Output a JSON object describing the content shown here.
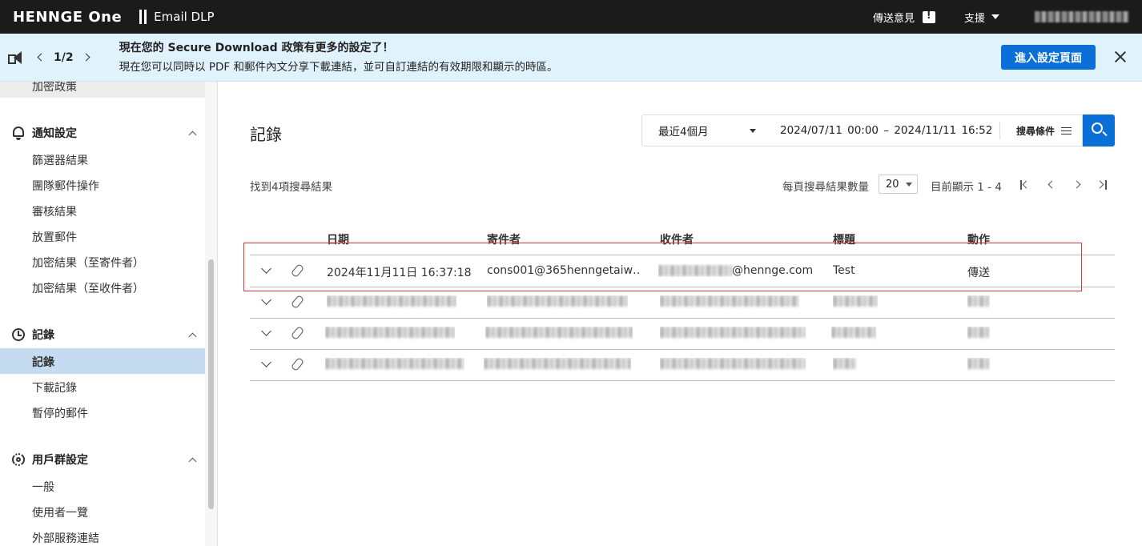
{
  "topbar": {
    "logo": "HENNGE One",
    "product": "Email DLP",
    "feedback_label": "傳送意見",
    "support_label": "支援"
  },
  "announcement": {
    "page": "1/2",
    "title": "現在您的 Secure Download 政策有更多的設定了！",
    "body": "現在您可以同時以 PDF 和郵件內文分享下載連結，並可自訂連結的有效期限和顯示的時區。",
    "button": "進入設定頁面"
  },
  "sidebar": {
    "top_item": "加密政策",
    "groups": [
      {
        "label": "通知設定",
        "items": [
          "篩選器結果",
          "團隊郵件操作",
          "審核結果",
          "放置郵件",
          "加密結果（至寄件者）",
          "加密結果（至收件者）"
        ]
      },
      {
        "label": "記錄",
        "items": [
          "記錄",
          "下載記錄",
          "暫停的郵件"
        ]
      },
      {
        "label": "用戶群設定",
        "items": [
          "一般",
          "使用者一覽",
          "外部服務連結"
        ]
      }
    ]
  },
  "main": {
    "title": "記錄",
    "range_select": "最近4個月",
    "date_range": "2024/07/11  00:00  –  2024/11/11  16:52",
    "conditions_label": "搜尋條件",
    "found_text": "找到4項搜尋結果",
    "per_page_label": "每頁搜尋結果數量",
    "per_page_value": "20",
    "showing_text": "目前顯示 1 - 4",
    "columns": [
      "日期",
      "寄件者",
      "收件者",
      "標題",
      "動作"
    ],
    "rows": [
      {
        "date": "2024年11月11日 16:37:18",
        "sender": "cons001@365henngetaiw…",
        "recipient_domain": "@hennge.com",
        "subject": "Test",
        "action": "傳送"
      }
    ]
  },
  "colors": {
    "topbar": "#1b1b1b",
    "announcement_bg": "#e0f3fc",
    "accent": "#0a6fd6",
    "sidebar_active": "#c5dbef",
    "highlight_border": "#dd3333"
  }
}
